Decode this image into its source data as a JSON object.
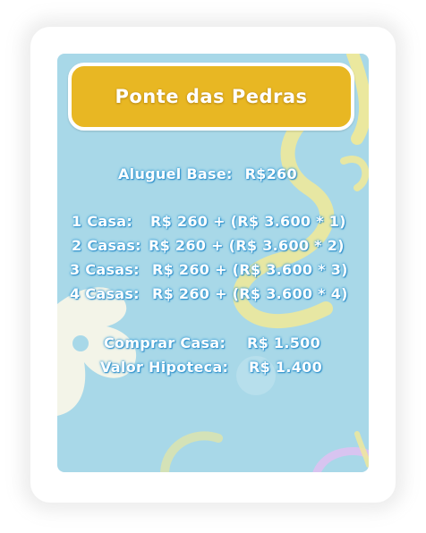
{
  "card": {
    "title": "Ponte das Pedras",
    "rent_base": {
      "label": "Aluguel Base:",
      "value": "R$260"
    },
    "house_rents": [
      {
        "label": "1 Casa:",
        "value": "R$ 260 + (R$ 3.600 * 1)"
      },
      {
        "label": "2 Casas:",
        "value": "R$ 260 + (R$ 3.600 * 2)"
      },
      {
        "label": "3 Casas:",
        "value": "R$ 260 + (R$ 3.600 * 3)"
      },
      {
        "label": "4 Casas:",
        "value": "R$ 260 + (R$ 3.600 * 4)"
      }
    ],
    "buy_house": {
      "label": "Comprar Casa:",
      "value": "R$ 1.500"
    },
    "mortgage": {
      "label": "Valor Hipoteca:",
      "value": "R$ 1.400"
    }
  },
  "colors": {
    "card_background": "#a8d8e8",
    "title_background": "#e8b723",
    "text": "#ffffff",
    "text_outline": "#3b9ed6"
  }
}
